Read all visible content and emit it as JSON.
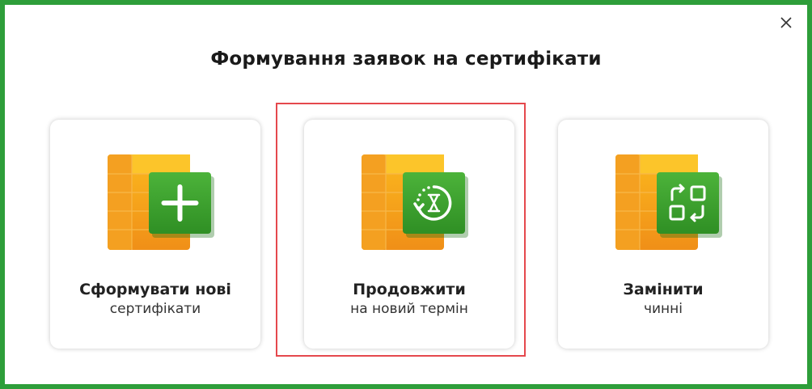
{
  "dialog": {
    "title": "Формування заявок на сертифікати",
    "close_icon": "close-icon"
  },
  "cards": [
    {
      "icon": "plus-icon",
      "line1": "Сформувати нові",
      "line2": "сертифікати"
    },
    {
      "icon": "renew-hourglass-icon",
      "line1": "Продовжити",
      "line2": "на новий термін"
    },
    {
      "icon": "replace-icon",
      "line1": "Замінити",
      "line2": "чинні"
    }
  ],
  "colors": {
    "frame_border": "#2e9e3a",
    "highlight": "#e5484d",
    "sheet_orange": "#f39a1c",
    "sheet_yellow": "#fbbd1c",
    "badge_green": "#3fa52c"
  }
}
